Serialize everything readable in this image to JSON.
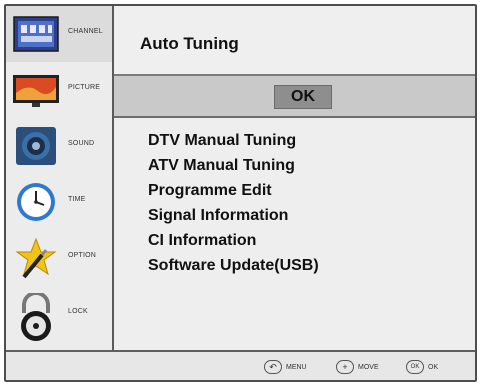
{
  "sidebar": {
    "items": [
      {
        "label": "CHANNEL",
        "icon": "channel-icon"
      },
      {
        "label": "PICTURE",
        "icon": "picture-icon"
      },
      {
        "label": "SOUND",
        "icon": "sound-icon"
      },
      {
        "label": "TIME",
        "icon": "clock-icon"
      },
      {
        "label": "OPTION",
        "icon": "option-icon"
      },
      {
        "label": "LOCK",
        "icon": "lock-icon"
      }
    ]
  },
  "main": {
    "title": "Auto Tuning",
    "ok_label": "OK",
    "menu": [
      "DTV Manual Tuning",
      "ATV Manual Tuning",
      "Programme Edit",
      "Signal Information",
      "CI Information",
      "Software Update(USB)"
    ]
  },
  "footer": {
    "menu_label": "MENU",
    "move_label": "MOVE",
    "ok_label": "OK",
    "ok_icon_text": "OK"
  },
  "colors": {
    "panel": "#eeeeee",
    "ok_bar": "#c9c9c9",
    "ok_button": "#8e8e8e",
    "border": "#4e4e4e"
  }
}
